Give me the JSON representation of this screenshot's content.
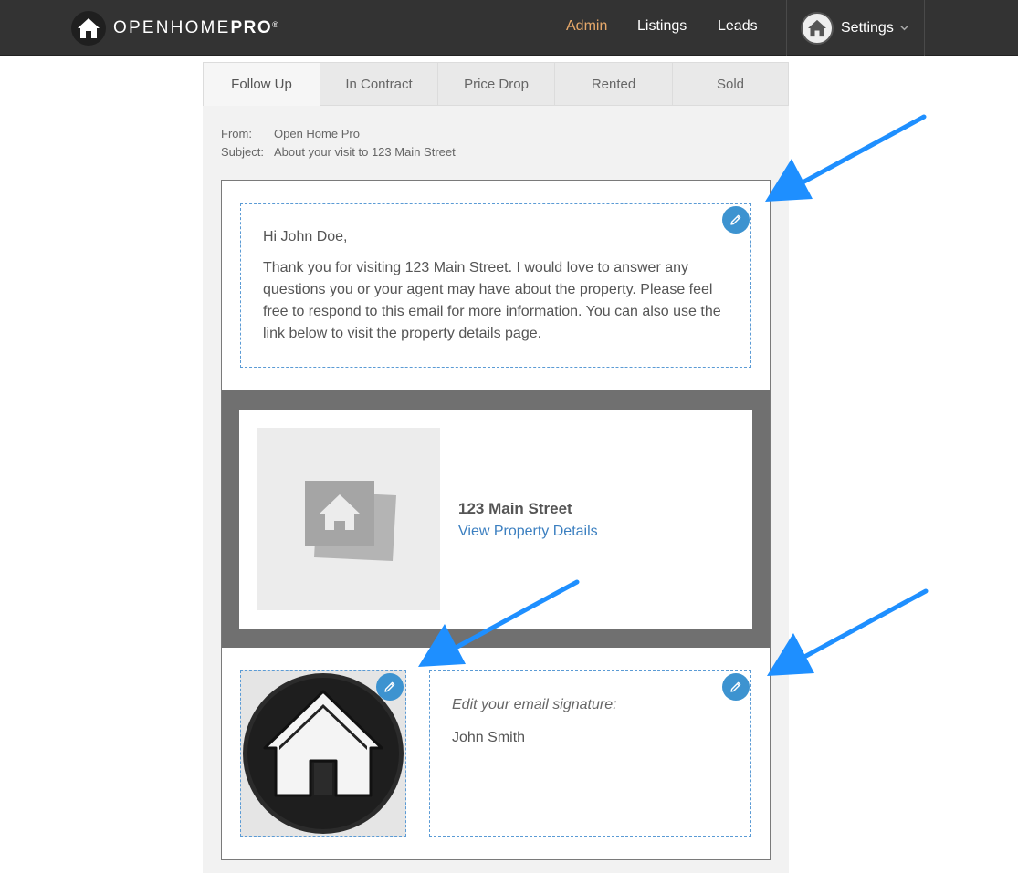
{
  "brand": {
    "name_light": "OPENHOME",
    "name_bold": "PRO",
    "mark": "®"
  },
  "nav": {
    "links": [
      {
        "label": "Admin",
        "active": true
      },
      {
        "label": "Listings",
        "active": false
      },
      {
        "label": "Leads",
        "active": false
      }
    ],
    "settings_label": "Settings"
  },
  "tabs": [
    "Follow Up",
    "In Contract",
    "Price Drop",
    "Rented",
    "Sold"
  ],
  "email": {
    "from_label": "From:",
    "from_value": "Open Home Pro",
    "subject_label": "Subject:",
    "subject_value": "About your visit to 123 Main Street",
    "greeting": "Hi John Doe,",
    "body": "Thank you for visiting 123 Main Street. I would love to answer any questions you or your agent may have about the property. Please feel free to respond to this email for more information. You can also use the link below to visit the property details page.",
    "property_address": "123 Main Street",
    "property_link": "View Property Details",
    "signature_hint": "Edit your email signature:",
    "signature_name": "John Smith"
  },
  "colors": {
    "topbar": "#333333",
    "active_nav": "#e8a96a",
    "link": "#3b7fc0",
    "edit_button": "#3d93d0",
    "annotation_arrow": "#1e8fff"
  }
}
